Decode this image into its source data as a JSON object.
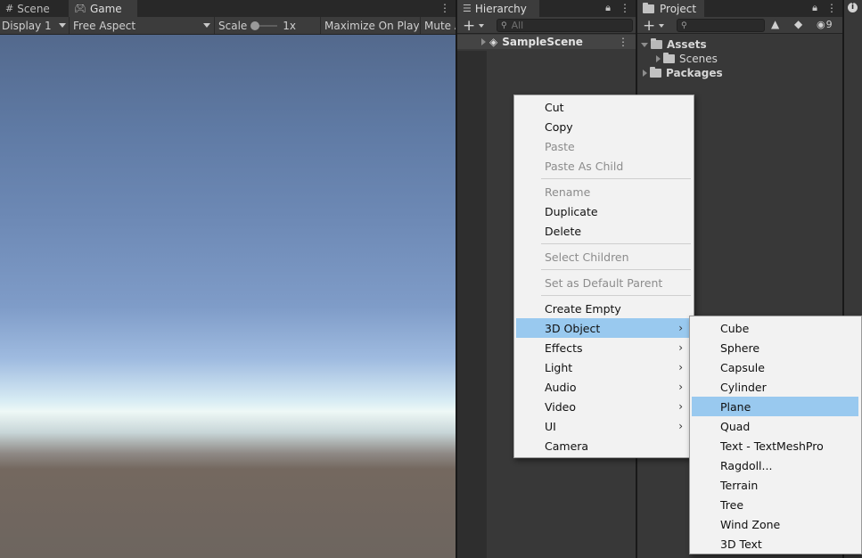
{
  "tabs": {
    "scene": "Scene",
    "game": "Game",
    "hierarchy": "Hierarchy",
    "project": "Project"
  },
  "game_toolbar": {
    "display": "Display 1",
    "aspect": "Free Aspect",
    "scale_label": "Scale",
    "scale_value": "1x",
    "maximize": "Maximize On Play",
    "mute": "Mute Audio"
  },
  "hierarchy": {
    "search_placeholder": "All",
    "scene_name": "SampleScene"
  },
  "project": {
    "hidden_count": "9",
    "tree": [
      {
        "label": "Assets"
      },
      {
        "label": "Scenes"
      },
      {
        "label": "Packages"
      }
    ]
  },
  "context_menu": {
    "items": [
      {
        "label": "Cut",
        "enabled": true
      },
      {
        "label": "Copy",
        "enabled": true
      },
      {
        "label": "Paste",
        "enabled": false
      },
      {
        "label": "Paste As Child",
        "enabled": false
      },
      {
        "label": "Rename",
        "enabled": false
      },
      {
        "label": "Duplicate",
        "enabled": true
      },
      {
        "label": "Delete",
        "enabled": true
      },
      {
        "label": "Select Children",
        "enabled": false
      },
      {
        "label": "Set as Default Parent",
        "enabled": false
      },
      {
        "label": "Create Empty",
        "enabled": true
      },
      {
        "label": "3D Object",
        "enabled": true,
        "submenu": true,
        "highlighted": true
      },
      {
        "label": "Effects",
        "enabled": true,
        "submenu": true
      },
      {
        "label": "Light",
        "enabled": true,
        "submenu": true
      },
      {
        "label": "Audio",
        "enabled": true,
        "submenu": true
      },
      {
        "label": "Video",
        "enabled": true,
        "submenu": true
      },
      {
        "label": "UI",
        "enabled": true,
        "submenu": true
      },
      {
        "label": "Camera",
        "enabled": true
      }
    ]
  },
  "submenu_3d": {
    "items": [
      {
        "label": "Cube"
      },
      {
        "label": "Sphere"
      },
      {
        "label": "Capsule"
      },
      {
        "label": "Cylinder"
      },
      {
        "label": "Plane",
        "highlighted": true
      },
      {
        "label": "Quad"
      },
      {
        "label": "Text - TextMeshPro"
      },
      {
        "label": "Ragdoll..."
      },
      {
        "label": "Terrain"
      },
      {
        "label": "Tree"
      },
      {
        "label": "Wind Zone"
      },
      {
        "label": "3D Text"
      }
    ]
  },
  "colors": {
    "menu_highlight": "#99c9ef",
    "panel_bg": "#383838"
  }
}
